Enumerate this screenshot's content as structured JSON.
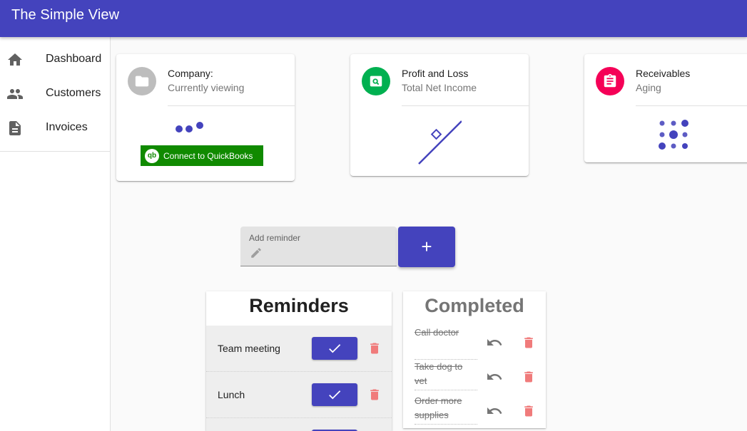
{
  "app": {
    "title": "The Simple View"
  },
  "sidebar": {
    "items": [
      {
        "label": "Dashboard",
        "icon": "home-icon"
      },
      {
        "label": "Customers",
        "icon": "people-icon"
      },
      {
        "label": "Invoices",
        "icon": "document-icon"
      }
    ]
  },
  "cards": {
    "company": {
      "title": "Company:",
      "subtitle": "Currently viewing",
      "icon": "folder-icon",
      "avatar_color": "#bdbdbd",
      "action_label": "Connect to QuickBooks",
      "action_color": "#108a00"
    },
    "profit": {
      "title": "Profit and Loss",
      "subtitle": "Total Net Income",
      "icon": "search-document-icon",
      "avatar_color": "#00b050"
    },
    "receivables": {
      "title": "Receivables",
      "subtitle": "Aging",
      "icon": "clipboard-icon",
      "avatar_color": "#f50057"
    }
  },
  "reminder_input": {
    "label": "Add reminder",
    "value": "",
    "add_label": "+"
  },
  "reminders": {
    "heading": "Reminders",
    "items": [
      {
        "text": "Team meeting"
      },
      {
        "text": "Lunch"
      }
    ]
  },
  "completed": {
    "heading": "Completed",
    "items": [
      {
        "text": "Call doctor"
      },
      {
        "text": "Take dog to vet"
      },
      {
        "text": "Order more supplies"
      }
    ]
  },
  "colors": {
    "primary": "#4443bd",
    "delete": "#f07b7b"
  }
}
